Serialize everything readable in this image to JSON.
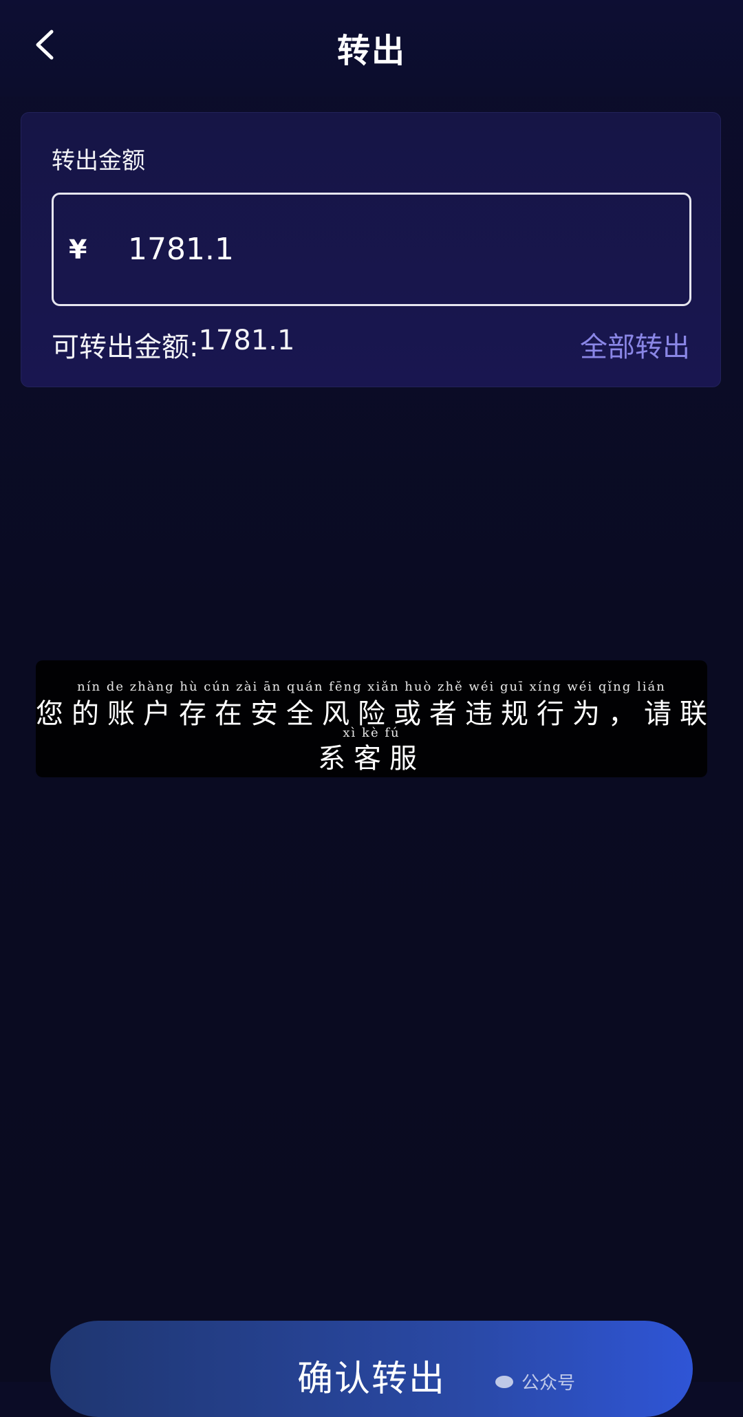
{
  "header": {
    "title": "转出",
    "back_icon": "chevron-left-icon"
  },
  "card": {
    "label": "转出金额",
    "currency_symbol": "¥",
    "amount_value": "1781.1",
    "available_label": "可转出金额:",
    "available_amount": "1781.1",
    "transfer_all_label": "全部转出",
    "transfer_all_color": "#8a86e6"
  },
  "warning": {
    "pinyin_line1": "nín de zhàng hù cún zài ān quán fēng xiǎn huò zhě wéi guī xíng wéi qǐng lián",
    "text_line1": "您的账户存在安全风险或者违规行为，请联",
    "pinyin_line2": "xì kè fú",
    "text_line2": "系客服"
  },
  "confirm": {
    "label": "确认转出"
  },
  "watermark": {
    "text": "公众号"
  },
  "colors": {
    "background": "#0b0c26",
    "card_background": "#181650",
    "button_gradient_start": "#1f3670",
    "button_gradient_end": "#2f55d6"
  }
}
